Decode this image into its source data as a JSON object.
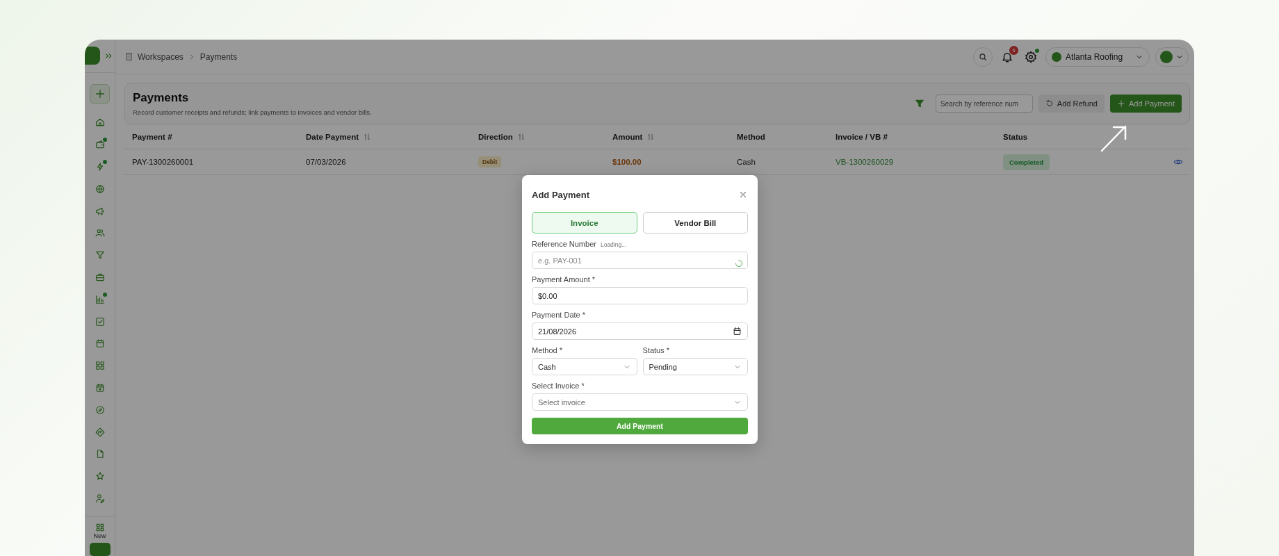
{
  "breadcrumb": [
    {
      "label": "Workspaces"
    },
    {
      "label": "Payments"
    }
  ],
  "topbar": {
    "notification_count": "6",
    "settings_dot": true,
    "workspace": "Atlanta Roofing"
  },
  "sidebar": {
    "items": [
      {
        "dot": false
      },
      {
        "dot": true
      },
      {
        "dot": true
      },
      {
        "dot": false
      },
      {
        "dot": false
      },
      {
        "dot": false
      },
      {
        "dot": false
      },
      {
        "dot": false
      },
      {
        "dot": true
      },
      {
        "dot": false
      },
      {
        "dot": false
      },
      {
        "dot": false
      },
      {
        "dot": false
      },
      {
        "dot": false
      },
      {
        "dot": false
      },
      {
        "dot": false
      },
      {
        "dot": false
      },
      {
        "dot": false
      }
    ],
    "new_label": "New"
  },
  "page": {
    "title": "Payments",
    "subtitle": "Record customer receipts and refunds; link payments to invoices and vendor bills.",
    "search": {
      "placeholder": "Search by reference num"
    },
    "buttons": [
      {
        "kind": "secondary",
        "label": "Add Refund"
      },
      {
        "kind": "primary",
        "label": "Add Payment"
      }
    ]
  },
  "table": {
    "columns": [
      {
        "label": "Payment #",
        "sortable": false
      },
      {
        "label": "Date Payment",
        "sortable": true
      },
      {
        "label": "Direction",
        "sortable": true
      },
      {
        "label": "Amount",
        "sortable": true
      },
      {
        "label": "Method",
        "sortable": false
      },
      {
        "label": "Invoice / VB #",
        "sortable": false
      },
      {
        "label": "Status",
        "sortable": false
      }
    ],
    "rows": [
      {
        "payment": "PAY-1300260001",
        "date": "07/03/2026",
        "direction": "Debit",
        "amount": "$100.00",
        "method": "Cash",
        "invoice": "VB-1300260029",
        "status": "Completed"
      }
    ]
  },
  "modal": {
    "title": "Add Payment",
    "tabs": [
      {
        "label": "Invoice",
        "selected": true
      },
      {
        "label": "Vendor Bill",
        "selected": false
      }
    ],
    "fields": [
      {
        "kind": "text",
        "label": "Reference Number",
        "note": "Loading...",
        "placeholder": "e.g. PAY-001",
        "loading": true
      },
      {
        "kind": "text",
        "label": "Payment Amount *",
        "value": "$0.00"
      },
      {
        "kind": "date",
        "label": "Payment Date *",
        "value": "21/08/2026"
      },
      {
        "kind": "pair",
        "fields": [
          {
            "kind": "select",
            "label": "Method *",
            "value": "Cash"
          },
          {
            "kind": "select",
            "label": "Status *",
            "value": "Pending"
          }
        ]
      },
      {
        "kind": "select",
        "label": "Select Invoice *",
        "placeholder": "Select invoice"
      }
    ],
    "submit": "Add Payment"
  }
}
